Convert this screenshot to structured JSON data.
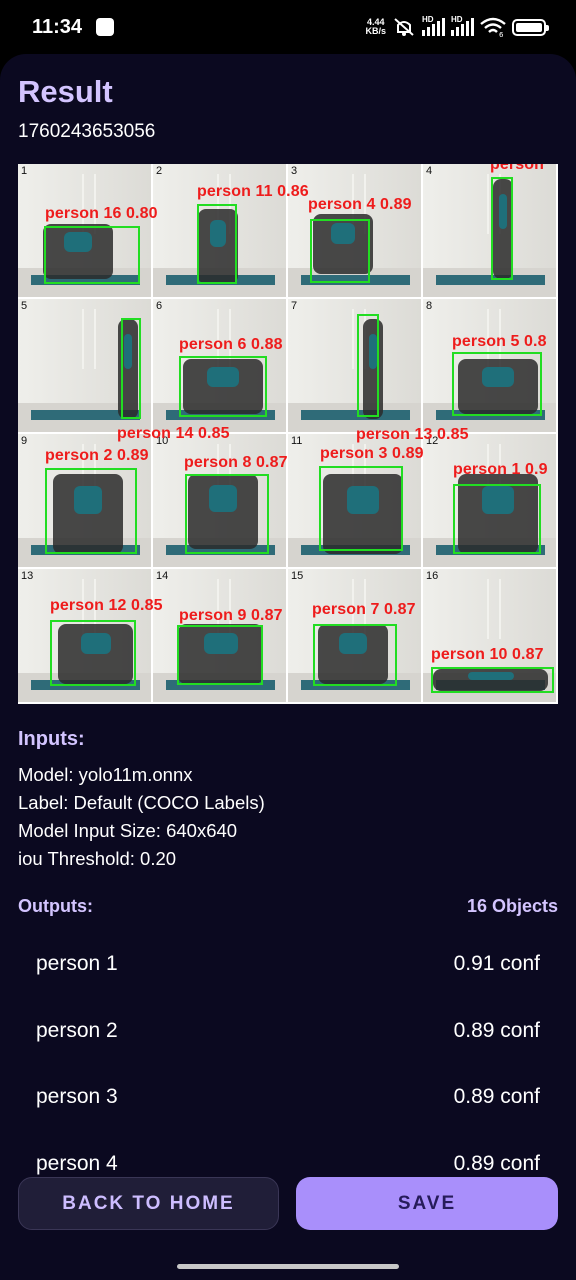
{
  "status_bar": {
    "time": "11:34",
    "net_speed_value": "4.44",
    "net_speed_unit": "KB/s",
    "signal_tag_1": "HD",
    "signal_tag_2": "HD",
    "wifi_tag": "6"
  },
  "page": {
    "title": "Result",
    "timestamp": "1760243653056"
  },
  "result_image": {
    "cells": [
      {
        "num": "1"
      },
      {
        "num": "2"
      },
      {
        "num": "3"
      },
      {
        "num": "4"
      },
      {
        "num": "5"
      },
      {
        "num": "6"
      },
      {
        "num": "7"
      },
      {
        "num": "8"
      },
      {
        "num": "9"
      },
      {
        "num": "10"
      },
      {
        "num": "11"
      },
      {
        "num": "12"
      },
      {
        "num": "13"
      },
      {
        "num": "14"
      },
      {
        "num": "15"
      },
      {
        "num": "16"
      }
    ],
    "detections": [
      {
        "label": "person 16  0.80"
      },
      {
        "label": "person 11  0.86"
      },
      {
        "label": "person 4  0.89"
      },
      {
        "label": "person"
      },
      {
        "label": "person 14  0.85"
      },
      {
        "label": "person 6  0.88"
      },
      {
        "label": "person 13  0.85"
      },
      {
        "label": "person 5  0.8"
      },
      {
        "label": "person 2  0.89"
      },
      {
        "label": "person 8  0.87"
      },
      {
        "label": "person 3  0.89"
      },
      {
        "label": "person 1  0.9"
      },
      {
        "label": "person 12  0.85"
      },
      {
        "label": "person 9  0.87"
      },
      {
        "label": "person 7  0.87"
      },
      {
        "label": "person 10  0.87"
      }
    ],
    "box_color": "#22dd22",
    "label_color": "#ee1c1c"
  },
  "inputs": {
    "heading": "Inputs:",
    "model": "Model: yolo11m.onnx",
    "label": "Label: Default (COCO Labels)",
    "input_size": "Model Input Size: 640x640",
    "iou": "iou Threshold: 0.20"
  },
  "outputs": {
    "heading": "Outputs:",
    "count": "16 Objects",
    "items": [
      {
        "label": "person 1",
        "conf": "0.91 conf"
      },
      {
        "label": "person 2",
        "conf": "0.89 conf"
      },
      {
        "label": "person 3",
        "conf": "0.89 conf"
      },
      {
        "label": "person 4",
        "conf": "0.89 conf"
      }
    ]
  },
  "buttons": {
    "back_home": "BACK TO HOME",
    "save": "SAVE"
  },
  "colors": {
    "accent": "#d3c4ff",
    "sheet_bg": "#0b0920",
    "save_bg": "#a98ffb"
  }
}
